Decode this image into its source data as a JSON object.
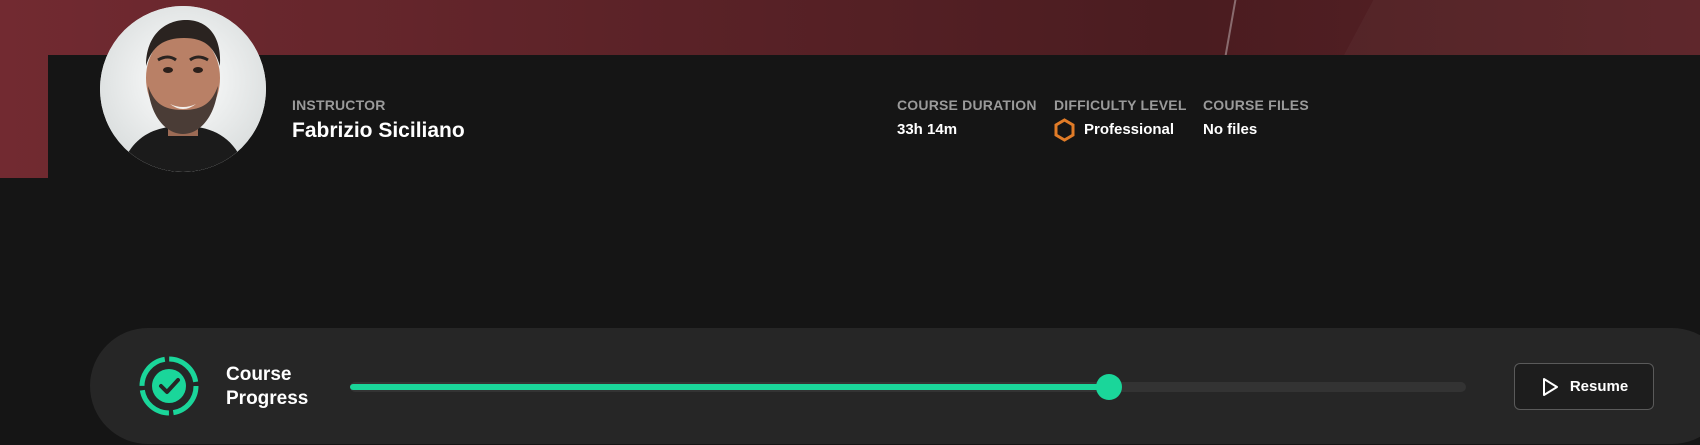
{
  "instructor": {
    "label": "INSTRUCTOR",
    "name": "Fabrizio Siciliano"
  },
  "stats": {
    "duration": {
      "label": "COURSE DURATION",
      "value": "33h 14m"
    },
    "difficulty": {
      "label": "DIFFICULTY LEVEL",
      "value": "Professional",
      "icon": "hexagon-icon",
      "icon_color": "#e07b27"
    },
    "files": {
      "label": "COURSE FILES",
      "value": "No files"
    }
  },
  "progress": {
    "title_line1": "Course",
    "title_line2": "Progress",
    "fraction": 0.68,
    "accent_color": "#1ad69a"
  },
  "resume": {
    "label": "Resume",
    "icon": "play-icon"
  },
  "colors": {
    "hero": "#5a2227",
    "panel": "#151515",
    "card": "#262626",
    "accent": "#1ad69a"
  }
}
